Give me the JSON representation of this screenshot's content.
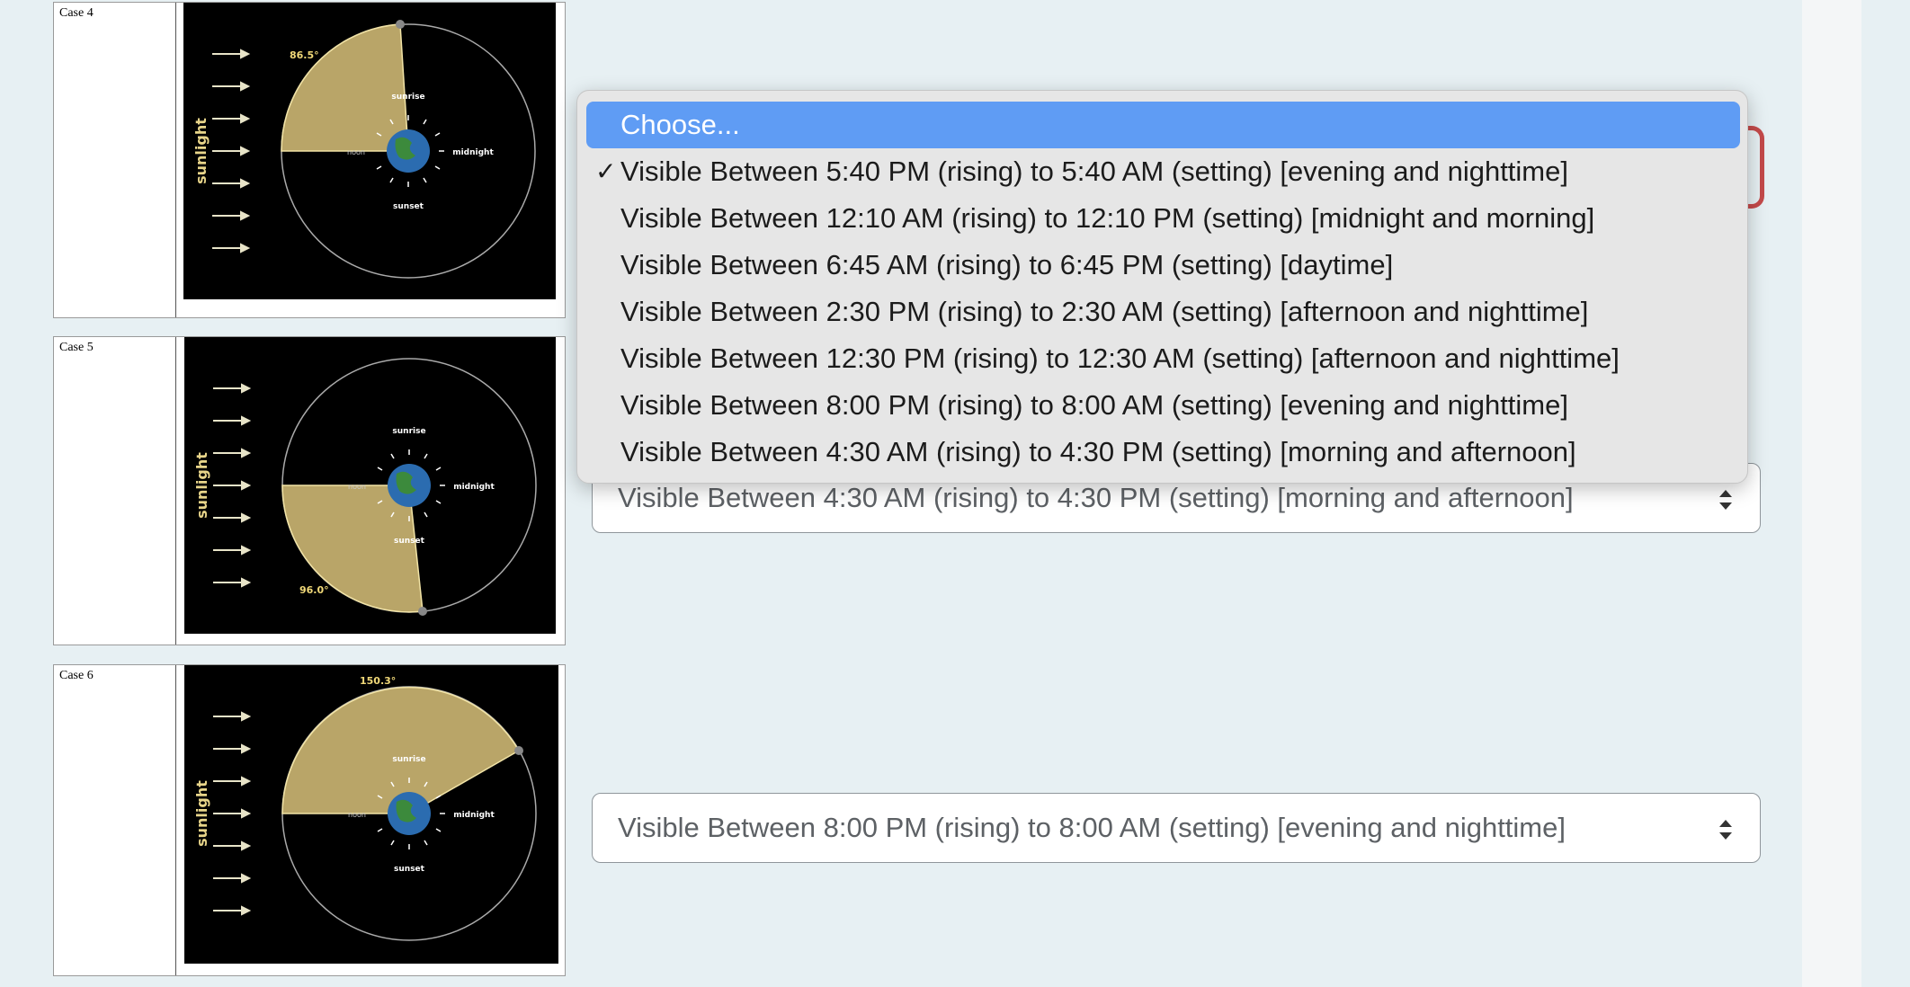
{
  "cases": [
    {
      "label": "Case 4",
      "angle_label": "86.5°",
      "sunlight": "sunlight",
      "sunrise": "sunrise",
      "noon": "noon",
      "midnight": "midnight",
      "sunset": "sunset"
    },
    {
      "label": "Case 5",
      "angle_label": "96.0°",
      "sunlight": "sunlight",
      "sunrise": "sunrise",
      "noon": "noon",
      "midnight": "midnight",
      "sunset": "sunset"
    },
    {
      "label": "Case 6",
      "angle_label": "150.3°",
      "sunlight": "sunlight",
      "sunrise": "sunrise",
      "noon": "noon",
      "midnight": "midnight",
      "sunset": "sunset"
    }
  ],
  "dropdown": {
    "checked_index": 1,
    "highlighted_index": 0,
    "options": [
      "Choose...",
      "Visible Between 5:40 PM (rising) to 5:40 AM (setting) [evening and nighttime]",
      "Visible Between 12:10 AM (rising) to 12:10 PM (setting) [midnight and morning]",
      "Visible Between 6:45 AM (rising) to 6:45 PM (setting) [daytime]",
      "Visible Between 2:30 PM (rising) to 2:30 AM (setting) [afternoon and nighttime]",
      "Visible Between 12:30 PM (rising) to 12:30 AM (setting) [afternoon and nighttime]",
      "Visible Between 8:00 PM (rising) to 8:00 AM (setting) [evening and nighttime]",
      "Visible Between 4:30 AM (rising) to 4:30 PM (setting) [morning and afternoon]"
    ]
  },
  "selects": {
    "case5_value": "Visible Between 4:30 AM (rising) to 4:30 PM (setting) [morning and afternoon]",
    "case6_value": "Visible Between 8:00 PM (rising) to 8:00 AM (setting) [evening and nighttime]"
  },
  "colors": {
    "highlight": "#5f9cf4",
    "wedge": "#d9c27a",
    "invalid_border": "#c44a4a",
    "page_bg": "#e7f0f3"
  },
  "icons": [
    "checkmark-icon",
    "select-arrows-icon",
    "sunlight-arrow-icon",
    "earth-icon",
    "moon-icon"
  ]
}
